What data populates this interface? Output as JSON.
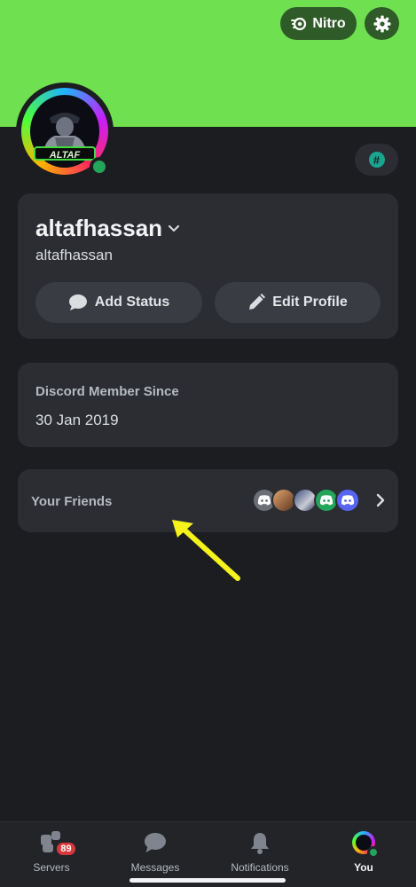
{
  "header": {
    "nitro_label": "Nitro",
    "banner_color": "#6fe04f"
  },
  "profile": {
    "display_name": "altafhassan",
    "username": "altafhassan",
    "avatar_text": "ALTAF",
    "status": "online",
    "status_color": "#23a55a"
  },
  "actions": {
    "add_status": "Add Status",
    "edit_profile": "Edit Profile"
  },
  "member": {
    "label": "Discord Member Since",
    "date": "30 Jan 2019"
  },
  "friends": {
    "label": "Your Friends"
  },
  "nav": {
    "servers": "Servers",
    "servers_badge": "89",
    "messages": "Messages",
    "notifications": "Notifications",
    "you": "You"
  },
  "colors": {
    "accent": "#5865f2",
    "arrow": "#f6f21c",
    "badge": "#da373c"
  }
}
